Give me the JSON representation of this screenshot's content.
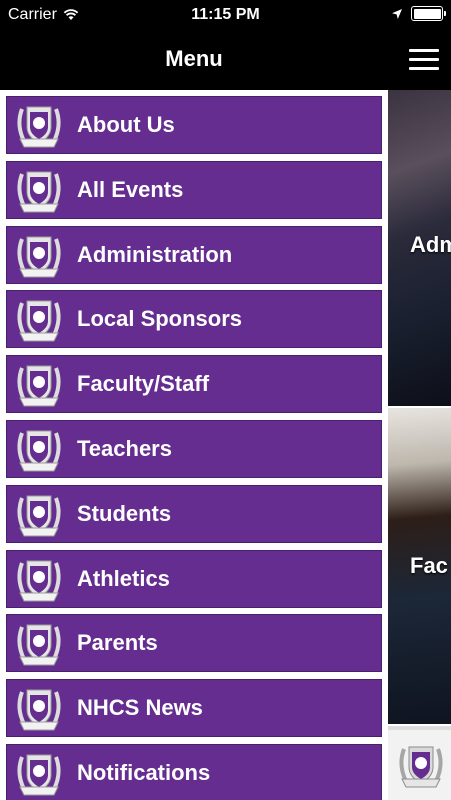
{
  "status_bar": {
    "carrier": "Carrier",
    "time": "11:15 PM"
  },
  "nav": {
    "title": "Menu"
  },
  "menu": {
    "items": [
      {
        "label": "About Us"
      },
      {
        "label": "All Events"
      },
      {
        "label": "Administration"
      },
      {
        "label": "Local Sponsors"
      },
      {
        "label": "Faculty/Staff"
      },
      {
        "label": "Teachers"
      },
      {
        "label": "Students"
      },
      {
        "label": "Athletics"
      },
      {
        "label": "Parents"
      },
      {
        "label": "NHCS News"
      },
      {
        "label": "Notifications"
      }
    ]
  },
  "background_cards": [
    {
      "label": "Adm"
    },
    {
      "label": "Fac"
    }
  ],
  "colors": {
    "accent": "#652d90",
    "bar": "#000000"
  }
}
